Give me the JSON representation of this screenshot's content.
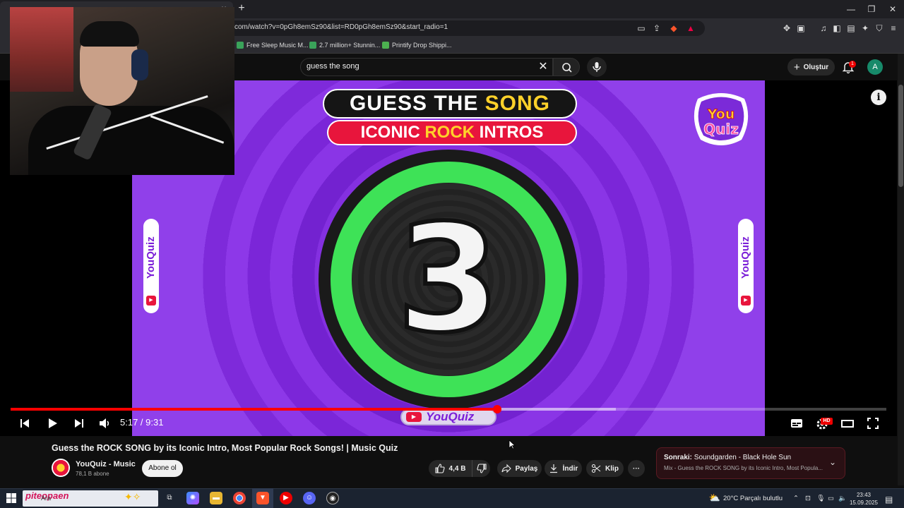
{
  "browser": {
    "tab_close": "×",
    "new_tab": "+",
    "url": "com/watch?v=0pGh8emSz90&list=RD0pGh8emSz90&start_radio=1",
    "bookmarks": [
      {
        "label": "Free Sleep Music M...",
        "color": "#3aa35a"
      },
      {
        "label": "2.7 million+ Stunnin...",
        "color": "#3aa35a"
      },
      {
        "label": "Printify Drop Shippi...",
        "color": "#4caf50"
      }
    ],
    "window_buttons": [
      "—",
      "❐",
      "✕"
    ]
  },
  "youtube_header": {
    "search_value": "guess the song",
    "create_label": "Oluştur",
    "notification_count": "1",
    "avatar_letter": "A"
  },
  "video_frame": {
    "title_line1_a": "GUESS THE ",
    "title_line1_b": "SONG",
    "title_line2_a": "ICONIC ",
    "title_line2_b": "ROCK",
    "title_line2_c": " INTROS",
    "logo_you": "You",
    "logo_quiz": "Quiz",
    "countdown": "3",
    "side_label": "YouQuiz",
    "bottom_label": "YouQuiz",
    "yt_play": "▶"
  },
  "player": {
    "time_current": "5:17",
    "time_separator": " / ",
    "time_total": "9:31",
    "progress_fraction": 0.556,
    "buffered_fraction": 0.691,
    "hd_badge": "HD"
  },
  "video_info": {
    "title": "Guess the ROCK SONG by its Iconic Intro, Most Popular Rock Songs! | Music Quiz",
    "channel_name": "YouQuiz - Music",
    "subscribers": "78,1 B abone",
    "subscribe_label": "Abone ol",
    "likes": "4,4 B",
    "share_label": "Paylaş",
    "download_label": "İndir",
    "clip_label": "Klip",
    "more_label": "···"
  },
  "next_up": {
    "prefix": "Sonraki:",
    "title": " Soundgarden - Black Hole Sun",
    "subtitle": "Mix - Guess the ROCK SONG by its Iconic Intro, Most Popula..."
  },
  "taskbar": {
    "search_brand": "piteopaen",
    "search_hint": "Ara",
    "weather": "20°C  Parçalı bulutlu",
    "time": "23:43",
    "date": "15.09.2025"
  },
  "colors": {
    "accent_red": "#ff0000",
    "video_purple": "#7d2ad8",
    "countdown_green": "#3ee257",
    "quiz_yellow": "#ffd12a"
  }
}
